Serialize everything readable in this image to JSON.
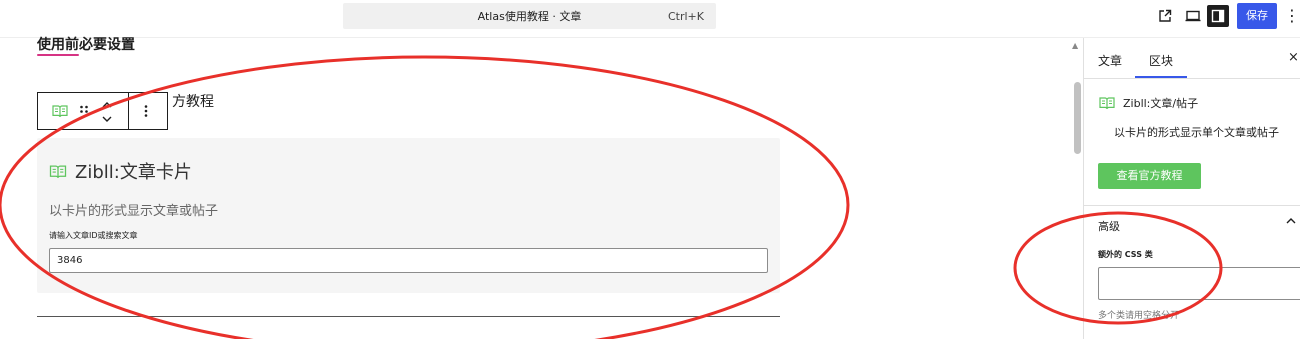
{
  "topbar": {
    "document_title": "Atlas使用教程 · 文章",
    "shortcut": "Ctrl+K",
    "save_label": "保存",
    "more_label": "⋮"
  },
  "editor": {
    "heading": "使用前必要设置",
    "toolbar_trailing_label": "方教程",
    "card": {
      "title": "Zibll:文章卡片",
      "description": "以卡片的形式显示文章或帖子",
      "field_label": "请输入文章ID或搜索文章",
      "field_value": "3846"
    }
  },
  "sidebar": {
    "tabs": [
      "文章",
      "区块"
    ],
    "active_tab": "区块",
    "close_label": "×",
    "block_name": "Zibll:文章/帖子",
    "block_description": "以卡片的形式显示单个文章或帖子",
    "view_tutorial_button": "查看官方教程",
    "advanced_section": "高级",
    "css_class_label": "额外的 CSS 类",
    "css_class_value": "",
    "css_help": "多个类请用空格分开"
  },
  "colors": {
    "accent": "#3858e9",
    "green_button": "#5ec55e",
    "annotation": "#e8302a",
    "card_bg": "#f5f5f5"
  },
  "icons": [
    "book-icon",
    "drag-handle-icon",
    "move-up-down-icon",
    "more-options-icon",
    "external-link-icon",
    "view-icon",
    "sidebar-toggle-icon",
    "close-icon",
    "chevron-up-icon"
  ]
}
